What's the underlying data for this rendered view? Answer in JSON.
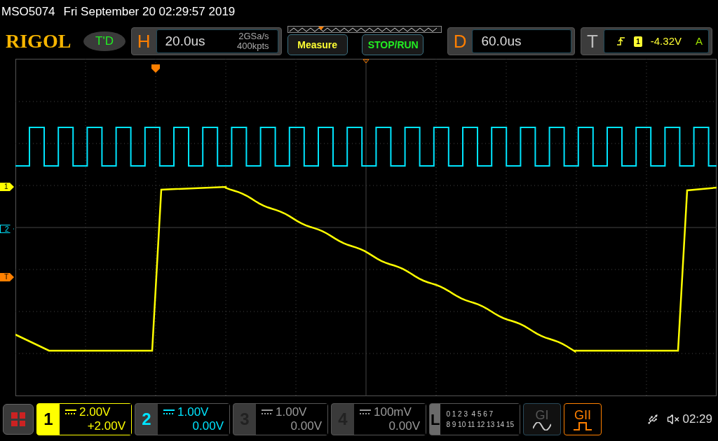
{
  "header": {
    "model": "MSO5074",
    "datetime": "Fri September 20 02:29:57 2019"
  },
  "logo": "RIGOL",
  "trigger_status": "T'D",
  "horizontal": {
    "label": "H",
    "timebase": "20.0us",
    "sample_rate": "2GSa/s",
    "memory_depth": "400kpts"
  },
  "buttons": [
    {
      "label": "Measure",
      "kind": "measure"
    },
    {
      "label": "STOP/RUN",
      "kind": "run"
    }
  ],
  "delay": {
    "label": "D",
    "value": "60.0us"
  },
  "trigger": {
    "label": "T",
    "source": "1",
    "level": "-4.32V",
    "mode": "A"
  },
  "screen_markers": [
    {
      "label": "1",
      "kind": "filled",
      "color": "#ffff00"
    },
    {
      "label": "2",
      "kind": "outline",
      "color": "#00e5ff"
    },
    {
      "label": "T",
      "kind": "filled",
      "color": "#ff8000"
    }
  ],
  "channels": [
    {
      "label": "1",
      "scale": "2.00V",
      "offset": "+2.00V",
      "selected": true,
      "color": "#ffff00"
    },
    {
      "label": "2",
      "scale": "1.00V",
      "offset": "0.00V",
      "selected": false,
      "color": "#00e5ff"
    },
    {
      "label": "3",
      "scale": "1.00V",
      "offset": "0.00V",
      "selected": false,
      "color": "#9a9a9a"
    },
    {
      "label": "4",
      "scale": "100mV",
      "offset": "0.00V",
      "selected": false,
      "color": "#9a9a9a"
    }
  ],
  "logic": {
    "label": "L",
    "rows": [
      "0 1 2 3  4 5 6 7",
      "8 9 10 11 12 13 14 15"
    ]
  },
  "generators": [
    {
      "label": "GI",
      "on": false,
      "kind": "sine"
    },
    {
      "label": "GII",
      "on": true,
      "kind": "pulse"
    }
  ],
  "status_bar": {
    "time": "02:29"
  }
}
